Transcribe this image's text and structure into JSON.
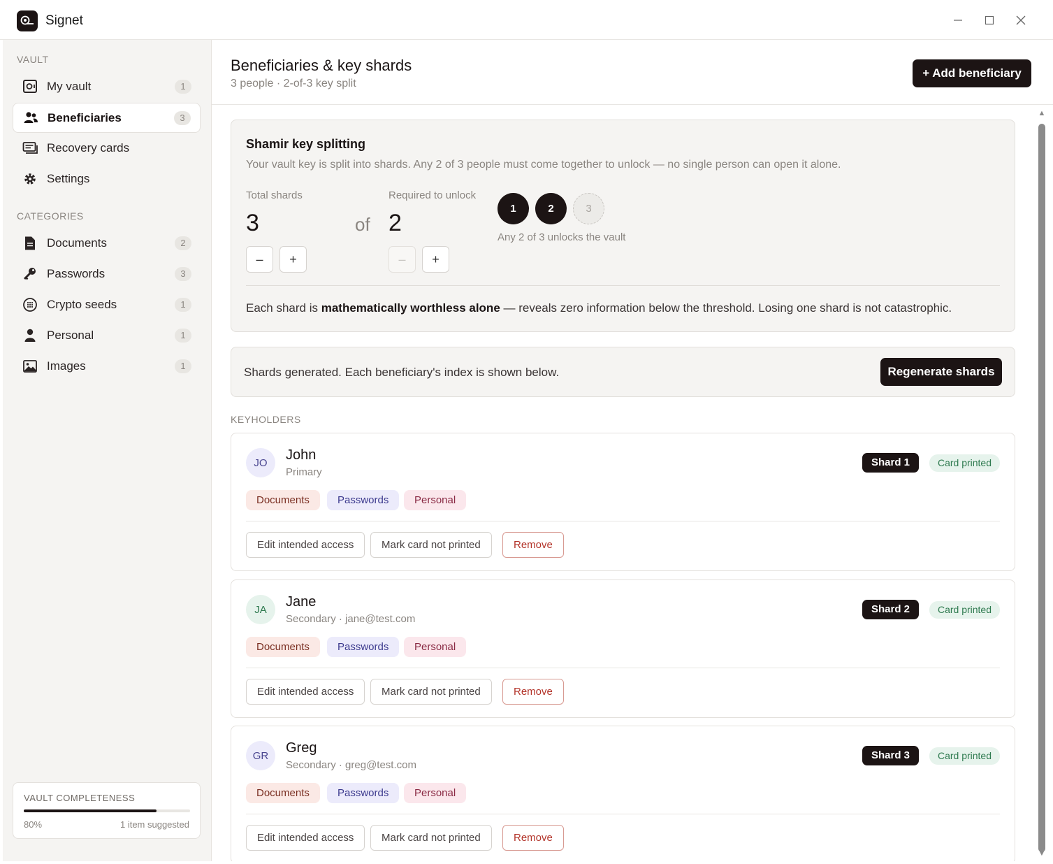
{
  "app": {
    "title": "Signet"
  },
  "sidebar": {
    "vault_label": "VAULT",
    "vault_items": [
      {
        "label": "My vault",
        "count": "1",
        "icon": "safe-icon"
      },
      {
        "label": "Beneficiaries",
        "count": "3",
        "icon": "people-icon",
        "active": true
      },
      {
        "label": "Recovery cards",
        "count": "",
        "icon": "cards-icon"
      },
      {
        "label": "Settings",
        "count": "",
        "icon": "gear-icon"
      }
    ],
    "categories_label": "CATEGORIES",
    "categories": [
      {
        "label": "Documents",
        "count": "2",
        "icon": "document-icon"
      },
      {
        "label": "Passwords",
        "count": "3",
        "icon": "key-icon"
      },
      {
        "label": "Crypto seeds",
        "count": "1",
        "icon": "grid-circle-icon"
      },
      {
        "label": "Personal",
        "count": "1",
        "icon": "person-icon"
      },
      {
        "label": "Images",
        "count": "1",
        "icon": "image-icon"
      }
    ],
    "completeness": {
      "label": "VAULT COMPLETENESS",
      "percent_text": "80%",
      "fraction": 0.8,
      "suggested": "1 item suggested"
    }
  },
  "header": {
    "title": "Beneficiaries & key shards",
    "subtitle": "3 people · 2-of-3 key split",
    "add_button": "+ Add beneficiary"
  },
  "shamir": {
    "title": "Shamir key splitting",
    "description": "Your vault key is split into shards. Any 2 of 3 people must come together to unlock — no single person can open it alone.",
    "total_label": "Total shards",
    "total_value": "3",
    "of_word": "of",
    "required_label": "Required to unlock",
    "required_value": "2",
    "minus": "–",
    "plus": "+",
    "dots": [
      "1",
      "2",
      "3"
    ],
    "dots_caption": "Any 2 of 3 unlocks the vault",
    "note_prefix": "Each shard is ",
    "note_bold": "mathematically worthless alone",
    "note_suffix": " — reveals zero information below the threshold. Losing one shard is not catastrophic."
  },
  "generated": {
    "text": "Shards generated. Each beneficiary's index is shown below.",
    "button": "Regenerate shards"
  },
  "keyholders_label": "KEYHOLDERS",
  "people": [
    {
      "initials": "JO",
      "name": "John",
      "role": "Primary",
      "shard": "Shard 1",
      "status": "Card printed",
      "tags": [
        "Documents",
        "Passwords",
        "Personal"
      ],
      "actions": [
        "Edit intended access",
        "Mark card not printed",
        "Remove"
      ]
    },
    {
      "initials": "JA",
      "name": "Jane",
      "role": "Secondary · jane@test.com",
      "shard": "Shard 2",
      "status": "Card printed",
      "tags": [
        "Documents",
        "Passwords",
        "Personal"
      ],
      "actions": [
        "Edit intended access",
        "Mark card not printed",
        "Remove"
      ]
    },
    {
      "initials": "GR",
      "name": "Greg",
      "role": "Secondary · greg@test.com",
      "shard": "Shard 3",
      "status": "Card printed",
      "tags": [
        "Documents",
        "Passwords",
        "Personal"
      ],
      "actions": [
        "Edit intended access",
        "Mark card not printed",
        "Remove"
      ]
    }
  ],
  "colors": {
    "accent": "#1c1414",
    "sidebar_bg": "#f5f4f2",
    "success": "#2e7a4f",
    "danger": "#b3342a"
  }
}
